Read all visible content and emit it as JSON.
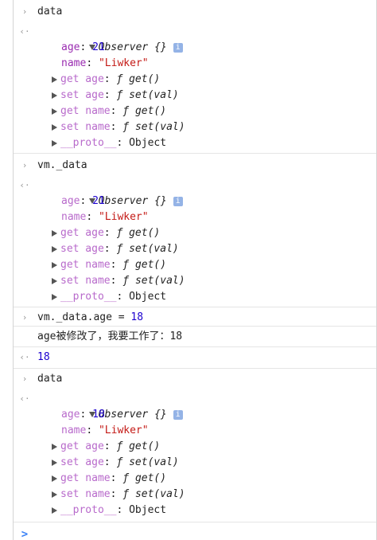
{
  "glyphs": {
    "input_prompt": "›",
    "output_prompt": "‹·",
    "result_prompt": "‹·",
    "colon": ": ",
    "f": "ƒ",
    "info": "i"
  },
  "entry1": {
    "command": "data",
    "object_header": "Observer {}",
    "props": [
      {
        "key": "age",
        "value": "21"
      },
      {
        "key": "name",
        "value": "\"Liwker\""
      }
    ],
    "accessors": [
      {
        "key": "get age",
        "fn": "get()"
      },
      {
        "key": "set age",
        "fn": "set(val)"
      },
      {
        "key": "get name",
        "fn": "get()"
      },
      {
        "key": "set name",
        "fn": "set(val)"
      },
      {
        "key": "__proto__",
        "value": "Object"
      }
    ]
  },
  "entry2": {
    "command": "vm._data",
    "object_header": "Observer {}",
    "props": [
      {
        "key": "age",
        "value": "21"
      },
      {
        "key": "name",
        "value": "\"Liwker\""
      }
    ],
    "accessors": [
      {
        "key": "get age",
        "fn": "get()"
      },
      {
        "key": "set age",
        "fn": "set(val)"
      },
      {
        "key": "get name",
        "fn": "get()"
      },
      {
        "key": "set name",
        "fn": "set(val)"
      },
      {
        "key": "__proto__",
        "value": "Object"
      }
    ]
  },
  "entry3": {
    "command_prefix": "vm._data.age = ",
    "command_value": "18",
    "log": "age被修改了，我要工作了：18",
    "result": "18"
  },
  "entry4": {
    "command": "data",
    "object_header": "Observer {}",
    "props": [
      {
        "key": "age",
        "value": "18"
      },
      {
        "key": "name",
        "value": "\"Liwker\""
      }
    ],
    "accessors": [
      {
        "key": "get age",
        "fn": "get()"
      },
      {
        "key": "set age",
        "fn": "set(val)"
      },
      {
        "key": "get name",
        "fn": "get()"
      },
      {
        "key": "set name",
        "fn": "set(val)"
      },
      {
        "key": "__proto__",
        "value": "Object"
      }
    ]
  },
  "prompt": ">"
}
